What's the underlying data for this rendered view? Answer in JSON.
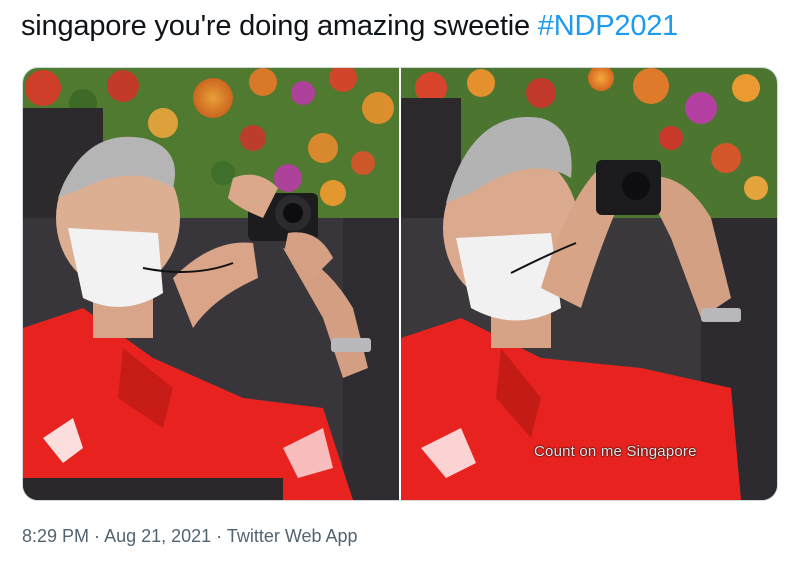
{
  "tweet": {
    "text": "singapore you're doing amazing sweetie ",
    "hashtag": "#NDP2021"
  },
  "media": {
    "left_image_icon": "photo-man-with-camera",
    "right_image_icon": "photo-man-with-camera-closeup",
    "caption": "Count on me Singapore"
  },
  "meta": {
    "time": "8:29 PM",
    "sep1": " · ",
    "date": "Aug 21, 2021",
    "sep2": " · ",
    "source": "Twitter Web App"
  },
  "colors": {
    "hashtag": "#1d9bf0",
    "meta_text": "#536471",
    "shirt_red": "#e8231f"
  }
}
